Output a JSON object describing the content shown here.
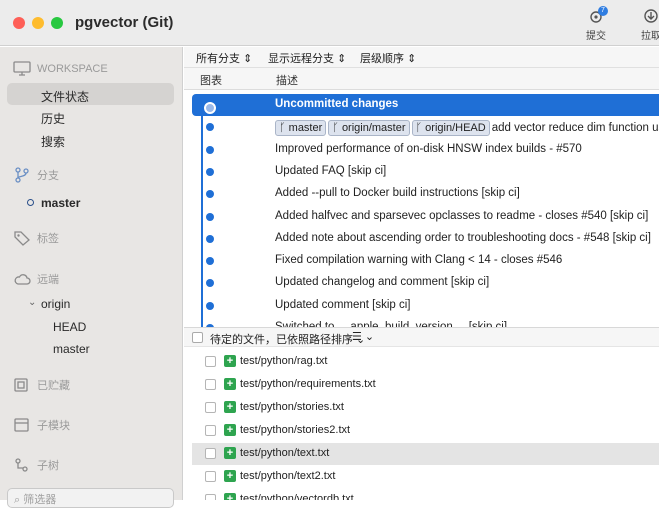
{
  "window": {
    "title": "pgvector (Git)"
  },
  "toolbar": {
    "commit_label": "提交",
    "commit_badge": "7",
    "pull_label": "拉取"
  },
  "sidebar": {
    "workspace": {
      "header": "WORKSPACE",
      "items": [
        "文件状态",
        "历史",
        "搜索"
      ]
    },
    "branches": {
      "header": "分支",
      "items": [
        "master"
      ]
    },
    "tags": {
      "header": "标签"
    },
    "remotes": {
      "header": "远端",
      "origin": "origin",
      "items": [
        "HEAD",
        "master"
      ]
    },
    "stashes": {
      "header": "已贮藏"
    },
    "submodules": {
      "header": "子模块"
    },
    "subtrees": {
      "header": "子树"
    },
    "filter_placeholder": "筛选器"
  },
  "filterbar": {
    "all_branches": "所有分支",
    "show_remote": "显示远程分支",
    "order": "层级顺序"
  },
  "columns": {
    "graph": "图表",
    "description": "描述"
  },
  "commits": [
    {
      "message": "Uncommitted changes",
      "selected": true
    },
    {
      "tags": [
        "master",
        "origin/master",
        "origin/HEAD"
      ],
      "message": "add vector reduce dim function use"
    },
    {
      "message": "Improved performance of on-disk HNSW index builds - #570"
    },
    {
      "message": "Updated FAQ [skip ci]"
    },
    {
      "message": "Added --pull to Docker build instructions [skip ci]"
    },
    {
      "message": "Added halfvec and sparsevec opclasses to readme - closes #540 [skip ci]"
    },
    {
      "message": "Added note about ascending order to troubleshooting docs - #548 [skip ci]"
    },
    {
      "message": "Fixed compilation warning with Clang < 14 - closes #546"
    },
    {
      "message": "Updated changelog and comment [skip ci]"
    },
    {
      "message": "Updated comment [skip ci]"
    },
    {
      "message": "Switched to __apple_build_version__ [skip ci]"
    }
  ],
  "files_header": {
    "label": "待定的文件，已依照路径排序 ⌄",
    "view_icon": "☰ ⌄"
  },
  "files": [
    "test/python/rag.txt",
    "test/python/requirements.txt",
    "test/python/stories.txt",
    "test/python/stories2.txt",
    "test/python/text.txt",
    "test/python/text2.txt",
    "test/python/vectordb.txt"
  ],
  "highlighted_file_index": 4
}
